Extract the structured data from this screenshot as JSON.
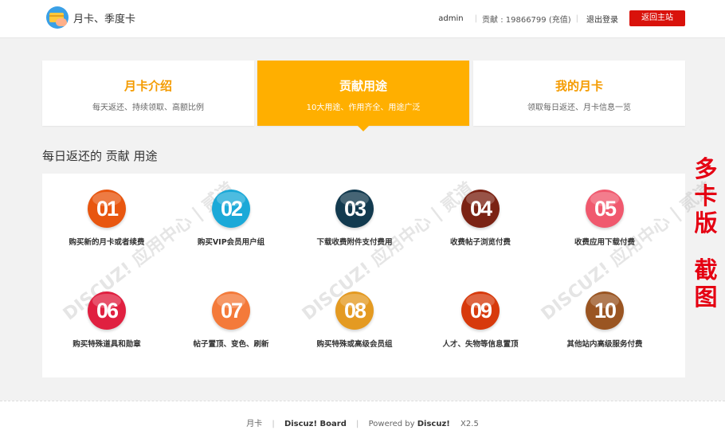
{
  "header": {
    "app_title": "月卡、季度卡",
    "username": "admin",
    "contribution_text": "贡献 : 19866799 (充值)",
    "logout_label": "退出登录",
    "home_button_label": "返回主站"
  },
  "tabs": [
    {
      "title": "月卡介绍",
      "subtitle": "每天返还、持续领取、高额比例",
      "active": false
    },
    {
      "title": "贡献用途",
      "subtitle": "10大用途、作用齐全、用途广泛",
      "active": true
    },
    {
      "title": "我的月卡",
      "subtitle": "领取每日返还、月卡信息一览",
      "active": false
    }
  ],
  "section_title": "每日返还的 贡献 用途",
  "uses": [
    {
      "num": "01",
      "label": "购买新的月卡或者续费",
      "color": "#e8560f"
    },
    {
      "num": "02",
      "label": "购买VIP会员用户组",
      "color": "#1ba9d8"
    },
    {
      "num": "03",
      "label": "下载收费附件支付费用",
      "color": "#123a4f"
    },
    {
      "num": "04",
      "label": "收费帖子浏览付费",
      "color": "#7b2314"
    },
    {
      "num": "05",
      "label": "收费应用下载付费",
      "color": "#f0596e"
    },
    {
      "num": "06",
      "label": "购买特殊道具和勋章",
      "color": "#e02040"
    },
    {
      "num": "07",
      "label": "帖子置顶、变色、刷新",
      "color": "#f47a3a"
    },
    {
      "num": "08",
      "label": "购买特殊或高级会员组",
      "color": "#e49a22"
    },
    {
      "num": "09",
      "label": "人才、失物等信息置顶",
      "color": "#d73a0c"
    },
    {
      "num": "10",
      "label": "其他站内高级服务付费",
      "color": "#9a5522"
    }
  ],
  "side_text": {
    "line1": "多",
    "line2": "卡",
    "line3": "版",
    "line4": "截",
    "line5": "图"
  },
  "footer": {
    "item1": "月卡",
    "item2": "Discuz! Board",
    "powered_prefix": "Powered by ",
    "powered_brand": "Discuz!",
    "version": "X2.5"
  },
  "colors": {
    "accent": "#ffaf00",
    "tab_title": "#f49b00",
    "home_button": "#d9120b",
    "side_text": "#e50012"
  }
}
